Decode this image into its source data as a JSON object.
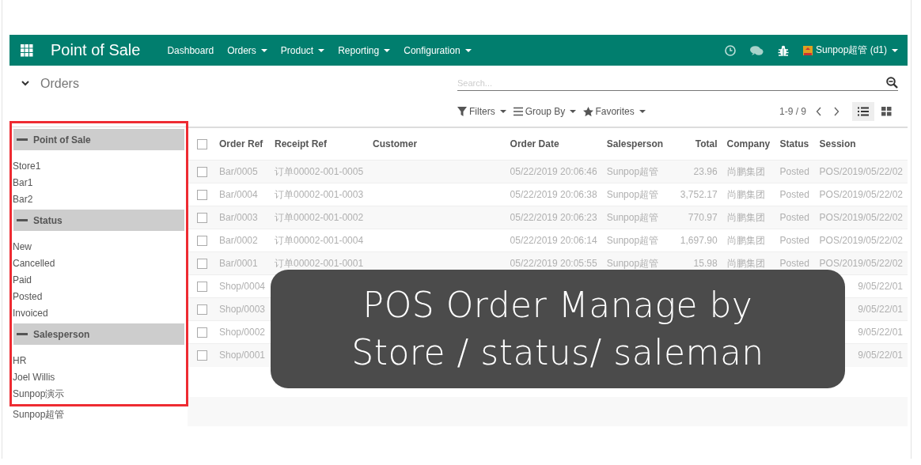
{
  "navbar": {
    "app_title": "Point of Sale",
    "menu": [
      {
        "label": "Dashboard",
        "dropdown": false
      },
      {
        "label": "Orders",
        "dropdown": true
      },
      {
        "label": "Product",
        "dropdown": true
      },
      {
        "label": "Reporting",
        "dropdown": true
      },
      {
        "label": "Configuration",
        "dropdown": true
      }
    ],
    "user": "Sunpop超管 (d1)"
  },
  "control_panel": {
    "breadcrumb": "Orders",
    "search": {
      "placeholder": "Search..."
    },
    "filters": [
      "Filters",
      "Group By",
      "Favorites"
    ],
    "pager": "1-9 / 9",
    "views": [
      {
        "kind": "list",
        "selected": true
      },
      {
        "kind": "kanban",
        "selected": false
      }
    ]
  },
  "sidebar": {
    "groups": [
      {
        "title": "Point of Sale",
        "items": [
          "Store1",
          "Bar1",
          "Bar2"
        ]
      },
      {
        "title": "Status",
        "items": [
          "New",
          "Cancelled",
          "Paid",
          "Posted",
          "Invoiced"
        ]
      },
      {
        "title": "Salesperson",
        "items": [
          "HR",
          "Joel Willis",
          "Sunpop演示",
          "Sunpop超管"
        ]
      }
    ]
  },
  "table": {
    "all_checked": false,
    "columns": [
      "Order Ref",
      "Receipt Ref",
      "Customer",
      "Order Date",
      "Salesperson",
      "Total",
      "Company",
      "Status",
      "Session"
    ],
    "rows": [
      {
        "kind": "full",
        "checked": false,
        "cells": [
          "Bar/0005",
          "订单00002-001-0005",
          "",
          "05/22/2019 20:06:46",
          "Sunpop超管",
          "23.96",
          "尚鹏集团",
          "Posted",
          "POS/2019/05/22/02"
        ]
      },
      {
        "kind": "full",
        "checked": false,
        "cells": [
          "Bar/0004",
          "订单00002-001-0003",
          "",
          "05/22/2019 20:06:38",
          "Sunpop超管",
          "3,752.17",
          "尚鹏集团",
          "Posted",
          "POS/2019/05/22/02"
        ]
      },
      {
        "kind": "full",
        "checked": false,
        "cells": [
          "Bar/0003",
          "订单00002-001-0002",
          "",
          "05/22/2019 20:06:23",
          "Sunpop超管",
          "770.97",
          "尚鹏集团",
          "Posted",
          "POS/2019/05/22/02"
        ]
      },
      {
        "kind": "full",
        "checked": false,
        "cells": [
          "Bar/0002",
          "订单00002-001-0004",
          "",
          "05/22/2019 20:06:14",
          "Sunpop超管",
          "1,697.90",
          "尚鹏集团",
          "Posted",
          "POS/2019/05/22/02"
        ]
      },
      {
        "kind": "full",
        "checked": false,
        "cells": [
          "Bar/0001",
          "订单00002-001-0001",
          "",
          "05/22/2019 20:05:55",
          "Sunpop超管",
          "15.98",
          "尚鹏集团",
          "Posted",
          "POS/2019/05/22/02"
        ]
      },
      {
        "kind": "partial",
        "checked": false,
        "cells": [
          "Shop/0004",
          "9/05/22/01"
        ]
      },
      {
        "kind": "partial",
        "checked": false,
        "cells": [
          "Shop/0003",
          "9/05/22/01"
        ]
      },
      {
        "kind": "partial",
        "checked": false,
        "cells": [
          "Shop/0002",
          "9/05/22/01"
        ]
      },
      {
        "kind": "partial",
        "checked": false,
        "cells": [
          "Shop/0001",
          "9/05/22/01"
        ]
      }
    ]
  },
  "caption": {
    "lines": [
      "POS Order Manage by",
      "Store / status/ saleman"
    ]
  }
}
